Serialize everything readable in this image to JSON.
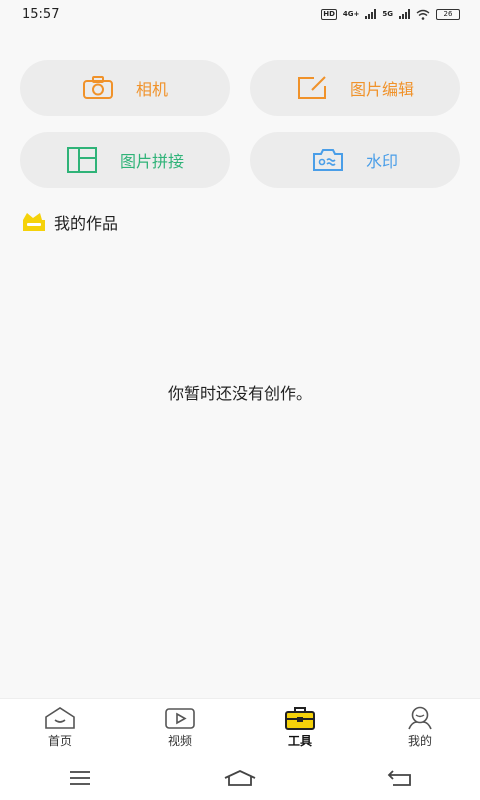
{
  "status_bar": {
    "time": "15:57",
    "hd": "HD",
    "network_1": "4G+",
    "network_2": "5G",
    "battery": "26"
  },
  "tools": [
    {
      "label": "相机",
      "icon": "camera-icon",
      "color": "#f0922a"
    },
    {
      "label": "图片编辑",
      "icon": "edit-icon",
      "color": "#f0922a"
    },
    {
      "label": "图片拼接",
      "icon": "collage-icon",
      "color": "#2fb378"
    },
    {
      "label": "水印",
      "icon": "watermark-icon",
      "color": "#4a9ee8"
    }
  ],
  "works_section": {
    "title": "我的作品",
    "icon": "works-icon",
    "empty_message": "你暂时还没有创作。"
  },
  "bottom_nav": [
    {
      "label": "首页",
      "icon": "home-icon",
      "active": false
    },
    {
      "label": "视频",
      "icon": "video-icon",
      "active": false
    },
    {
      "label": "工具",
      "icon": "toolbox-icon",
      "active": true
    },
    {
      "label": "我的",
      "icon": "profile-icon",
      "active": false
    }
  ],
  "system_nav": [
    "menu-icon",
    "home-icon",
    "back-icon"
  ],
  "colors": {
    "accent_yellow": "#f5d20a",
    "orange": "#f0922a",
    "green": "#2fb378",
    "blue": "#4a9ee8"
  }
}
